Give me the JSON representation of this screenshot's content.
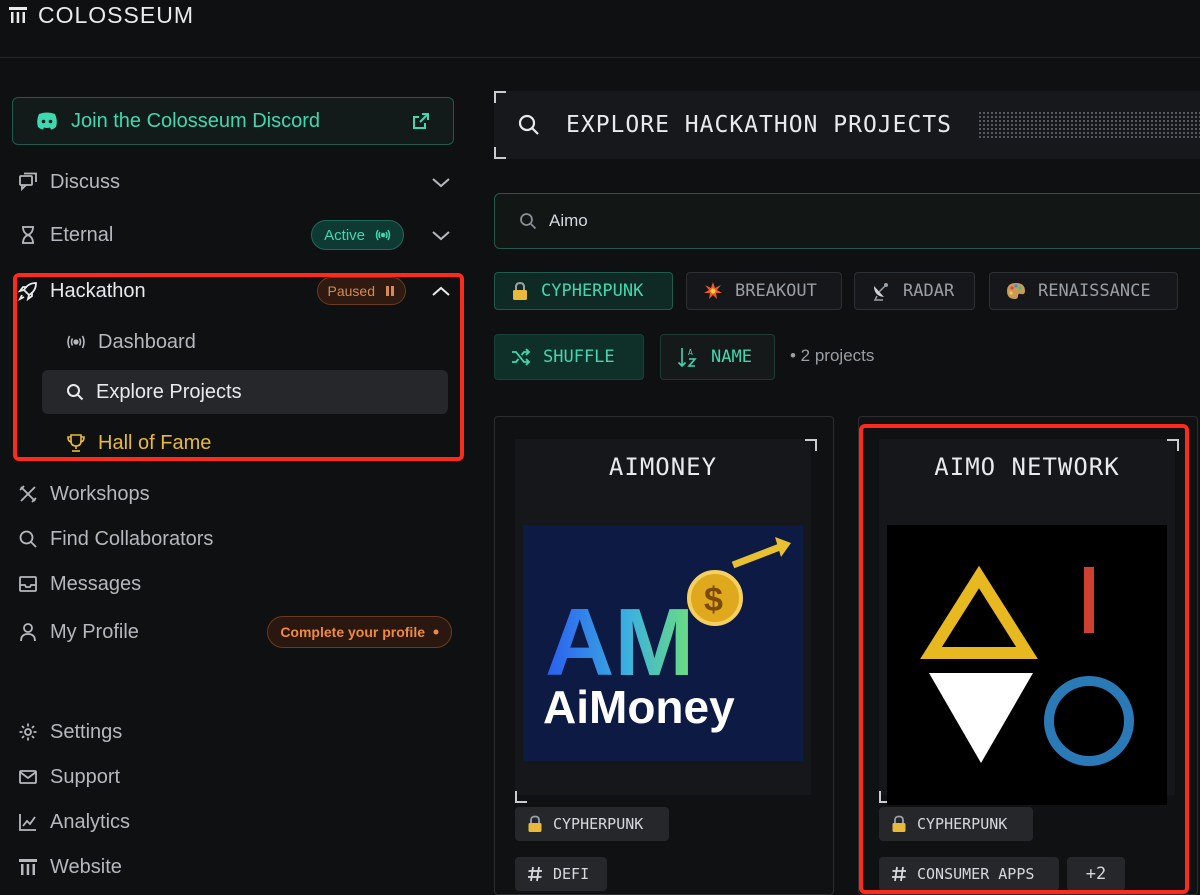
{
  "app": {
    "brand": "COLOSSEUM"
  },
  "sidebar": {
    "discord_label": "Join the Colosseum Discord",
    "discuss": "Discuss",
    "eternal": "Eternal",
    "eternal_badge": "Active",
    "hackathon": "Hackathon",
    "hackathon_badge": "Paused",
    "sub_items": [
      "Dashboard",
      "Explore Projects",
      "Hall of Fame"
    ],
    "workshops": "Workshops",
    "find_collaborators": "Find Collaborators",
    "messages": "Messages",
    "my_profile": "My Profile",
    "profile_badge": "Complete your profile",
    "settings": "Settings",
    "support": "Support",
    "analytics": "Analytics",
    "website": "Website"
  },
  "main": {
    "hero_title": "EXPLORE HACKATHON PROJECTS",
    "search_value": "Aimo",
    "chips": [
      "CYPHERPUNK",
      "BREAKOUT",
      "RADAR",
      "RENAISSANCE"
    ],
    "shuffle_label": "SHUFFLE",
    "sort_label": "NAME",
    "count_text": "• 2 projects",
    "cards": [
      {
        "title": "AIMONEY",
        "logo_top": "AM",
        "logo_bottom": "AiMoney",
        "coin": "$",
        "tags": [
          "CYPHERPUNK",
          "DEFI"
        ]
      },
      {
        "title": "AIMO NETWORK",
        "tags": [
          "CYPHERPUNK",
          "CONSUMER APPS",
          "+2"
        ]
      }
    ]
  },
  "colors": {
    "accent": "#3dd9b0",
    "highlight": "#ff2a1a",
    "warning": "#f08a3c",
    "gold": "#e8b93a"
  }
}
